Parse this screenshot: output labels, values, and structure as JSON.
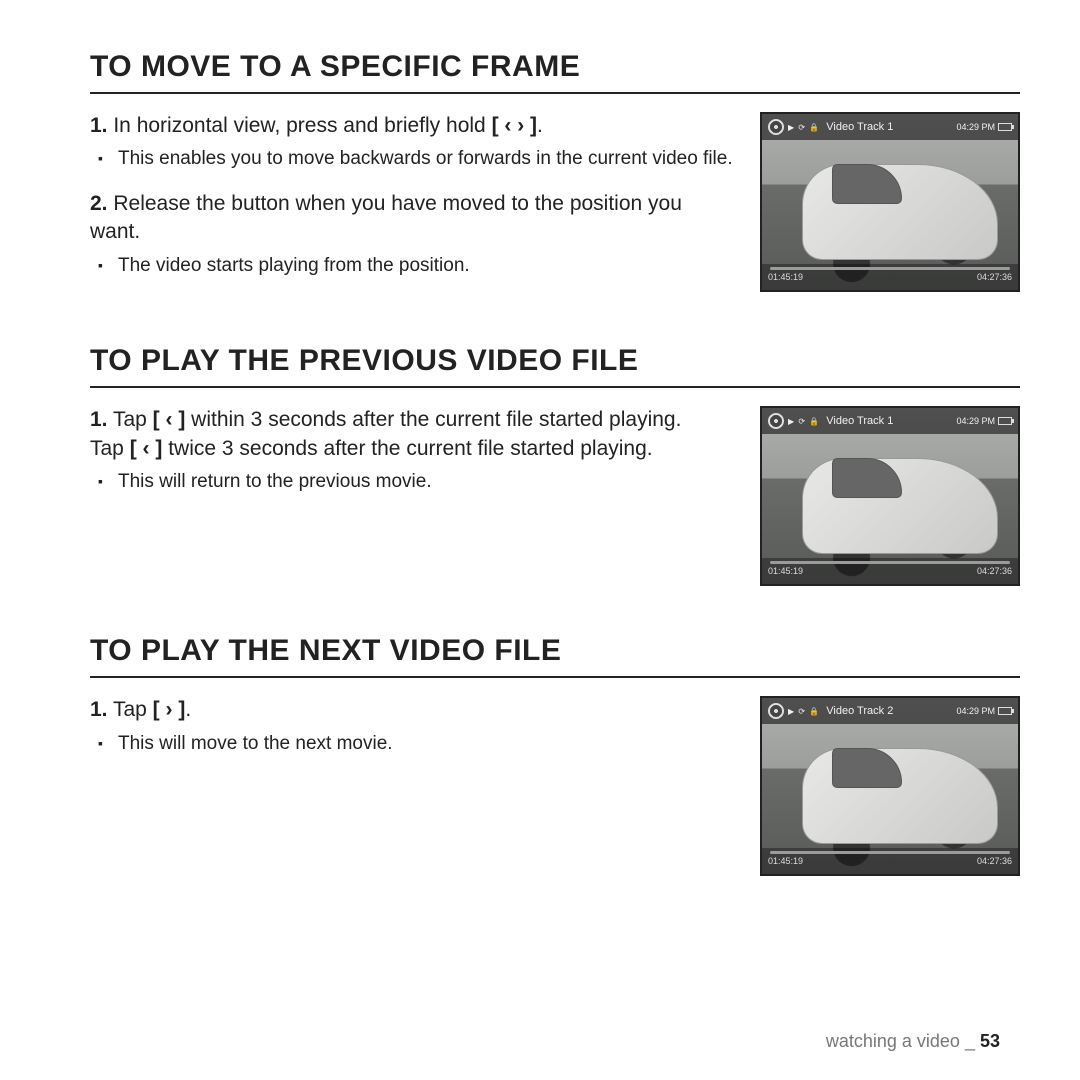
{
  "sections": [
    {
      "title": "TO MOVE TO A SPECIFIC FRAME",
      "steps": [
        {
          "num": "1.",
          "text_before": " In horizontal view, press and briefly hold ",
          "key": "[ ‹  › ]",
          "text_after": ".",
          "subs": [
            "This enables you to move backwards or forwards in the current video file."
          ]
        },
        {
          "num": "2.",
          "text_before": " Release the button when you have moved to the position you want.",
          "key": "",
          "text_after": "",
          "subs": [
            "The video starts playing from the position."
          ]
        }
      ],
      "thumb": {
        "track": "Video Track 1",
        "time": "04:29 PM",
        "tl": "01:45:19",
        "tr": "04:27:36"
      }
    },
    {
      "title": "TO PLAY THE PREVIOUS VIDEO FILE",
      "steps": [
        {
          "num": "1.",
          "text_before": " Tap ",
          "key": "[ ‹ ]",
          "text_after": " within 3 seconds after the current file started playing.",
          "line2_before": "Tap ",
          "line2_key": "[ ‹ ]",
          "line2_after": " twice 3 seconds after the current file started playing.",
          "subs": [
            "This will return to the previous movie."
          ]
        }
      ],
      "thumb": {
        "track": "Video Track 1",
        "time": "04:29 PM",
        "tl": "01:45:19",
        "tr": "04:27:36"
      }
    },
    {
      "title": "TO PLAY THE NEXT VIDEO FILE",
      "steps": [
        {
          "num": "1.",
          "text_before": " Tap ",
          "key": "[ › ]",
          "text_after": ".",
          "subs": [
            "This will move to the next movie."
          ]
        }
      ],
      "thumb": {
        "track": "Video Track 2",
        "time": "04:29 PM",
        "tl": "01:45:19",
        "tr": "04:27:36"
      }
    }
  ],
  "footer": {
    "label": "watching a video _ ",
    "page": "53"
  }
}
